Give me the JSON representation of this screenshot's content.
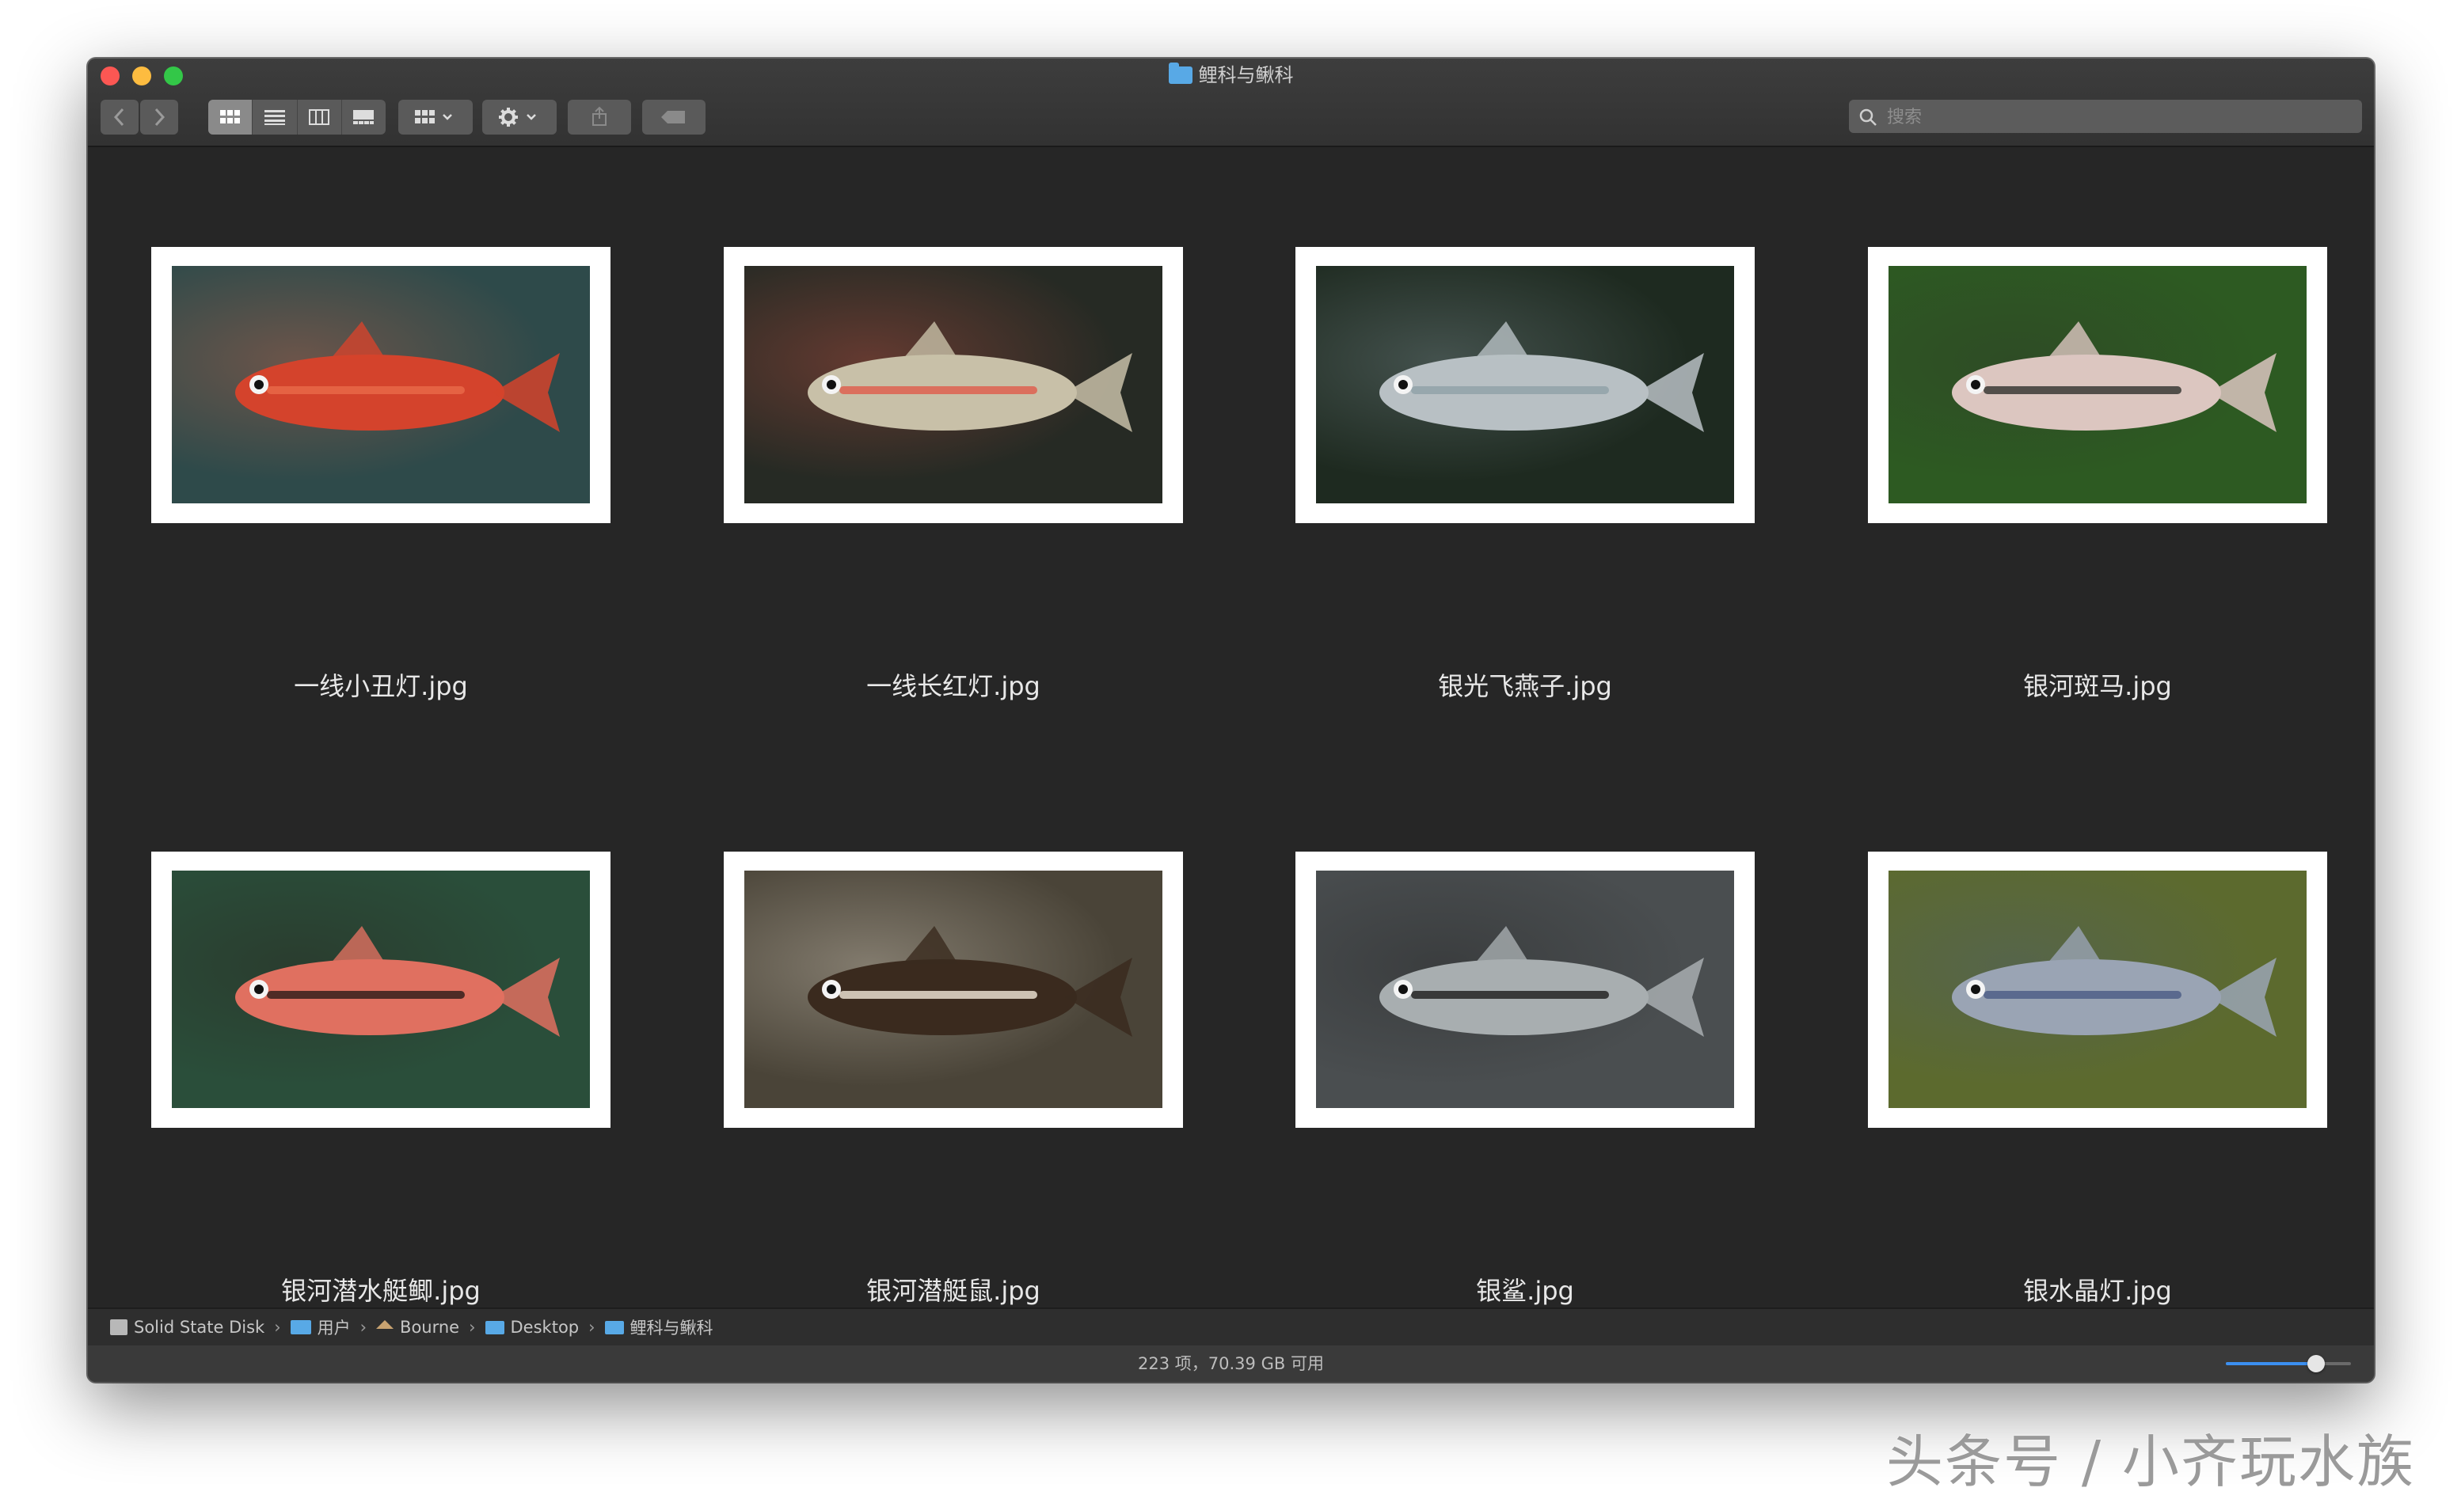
{
  "window": {
    "title": "鲤科与鳅科"
  },
  "toolbar": {
    "back_label": "‹",
    "forward_label": "›",
    "view_modes": [
      "icon",
      "list",
      "column",
      "gallery"
    ],
    "active_view": "icon",
    "group_label": "group-by",
    "action_label": "action",
    "share_label": "share",
    "tag_label": "tag"
  },
  "search": {
    "placeholder": "搜索",
    "value": ""
  },
  "files": [
    {
      "name": "一线小丑灯.jpg",
      "bg": "#2e4a4a",
      "fish": "#d4432c",
      "fish2": "#e86a4a"
    },
    {
      "name": "一线长红灯.jpg",
      "bg": "#262a24",
      "fish": "#c8c0a8",
      "fish2": "#e05a4a"
    },
    {
      "name": "银光飞燕子.jpg",
      "bg": "#1e2a20",
      "fish": "#b8c0c4",
      "fish2": "#8fa0a8"
    },
    {
      "name": "银河斑马.jpg",
      "bg": "#2d5a22",
      "fish": "#dcc6c0",
      "fish2": "#30302c"
    },
    {
      "name": "银河潜水艇鲫.jpg",
      "bg": "#2a4e3a",
      "fish": "#e07060",
      "fish2": "#2a1a18"
    },
    {
      "name": "银河潜艇鼠.jpg",
      "bg": "#4a4438",
      "fish": "#3a2a1e",
      "fish2": "#f2e8d8"
    },
    {
      "name": "银鲨.jpg",
      "bg": "#4a4e50",
      "fish": "#a8aeb0",
      "fish2": "#1c1c1c"
    },
    {
      "name": "银水晶灯.jpg",
      "bg": "#5c6a2e",
      "fish": "#9aa4b4",
      "fish2": "#4a5a84"
    }
  ],
  "pathbar": {
    "items": [
      "Solid State Disk",
      "用户",
      "Bourne",
      "Desktop",
      "鲤科与鳅科"
    ]
  },
  "status": {
    "text": "223 项，70.39 GB 可用"
  },
  "zoom": {
    "level": 0.72
  },
  "watermark": {
    "text": "头条号 / 小齐玩水族"
  }
}
